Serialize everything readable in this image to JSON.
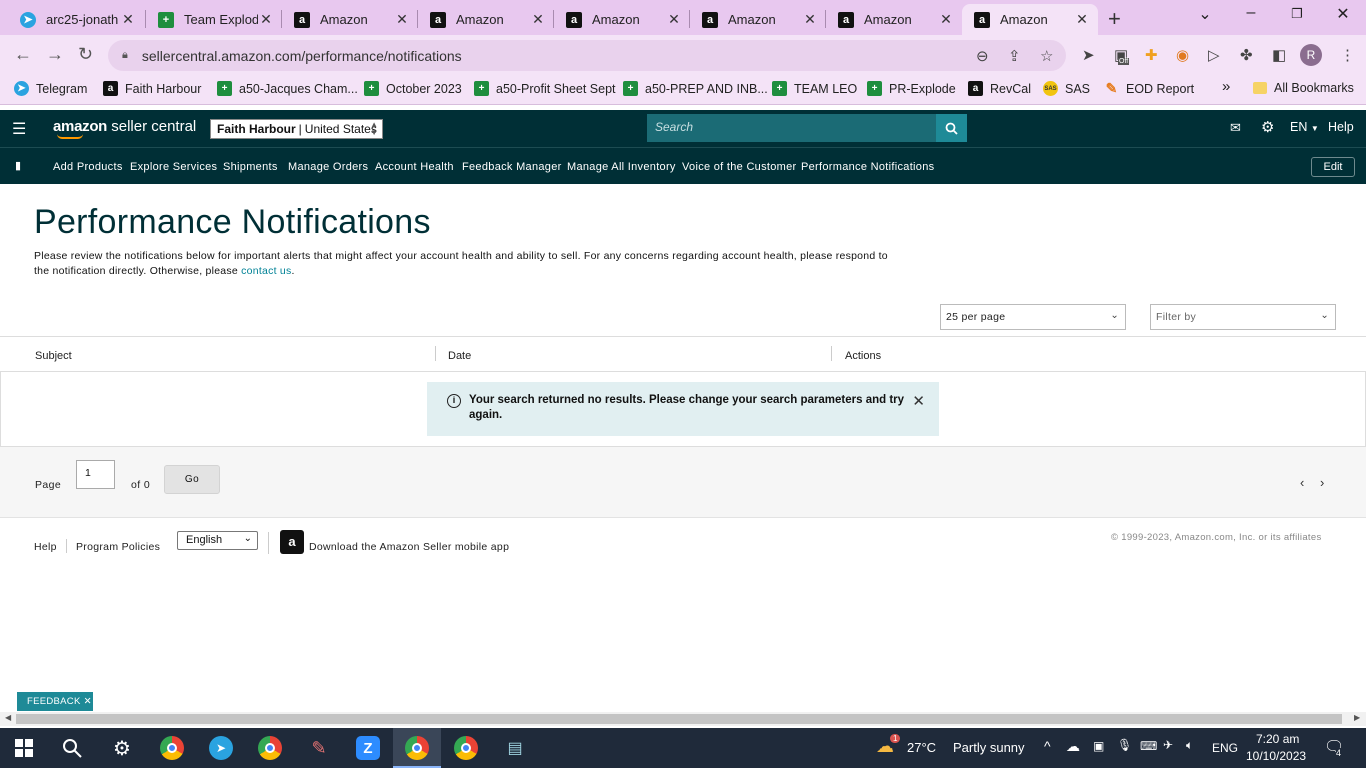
{
  "browser": {
    "tabs": [
      {
        "title": "arc25-jonath",
        "fav": "telegram-icon"
      },
      {
        "title": "Team Explod",
        "fav": "sheets-icon"
      },
      {
        "title": "Amazon",
        "fav": "amazon-icon"
      },
      {
        "title": "Amazon",
        "fav": "amazon-icon"
      },
      {
        "title": "Amazon",
        "fav": "amazon-icon"
      },
      {
        "title": "Amazon",
        "fav": "amazon-icon"
      },
      {
        "title": "Amazon",
        "fav": "amazon-icon"
      },
      {
        "title": "Amazon",
        "fav": "amazon-icon",
        "active": true
      }
    ],
    "url": "sellercentral.amazon.com/performance/notifications",
    "bookmarks": [
      {
        "label": "Telegram"
      },
      {
        "label": "Faith Harbour"
      },
      {
        "label": "a50-Jacques Cham..."
      },
      {
        "label": "October 2023"
      },
      {
        "label": "a50-Profit Sheet Sept"
      },
      {
        "label": "a50-PREP AND INB..."
      },
      {
        "label": "TEAM LEO"
      },
      {
        "label": "PR-Explode"
      },
      {
        "label": "RevCal"
      },
      {
        "label": "SAS"
      },
      {
        "label": "EOD Report"
      }
    ],
    "bookmarks_overflow": "»",
    "all_bookmarks": "All Bookmarks",
    "profile_initial": "R",
    "ext_badge": "Off"
  },
  "header": {
    "logo_main": "amazon",
    "logo_sub": "seller central",
    "account_name": "Faith Harbour",
    "account_region": "United States",
    "search_placeholder": "Search",
    "lang": "EN",
    "help": "Help"
  },
  "nav": {
    "links": [
      "Add Products",
      "Explore Services",
      "Shipments",
      "Manage Orders",
      "Account Health",
      "Feedback Manager",
      "Manage All Inventory",
      "Voice of the Customer",
      "Performance Notifications"
    ],
    "edit": "Edit"
  },
  "page": {
    "title": "Performance Notifications",
    "intro_text": "Please review the notifications below for important alerts that might affect your account health and ability to sell. For any concerns regarding account health, please respond to the notification directly. Otherwise, please ",
    "intro_link": "contact us",
    "intro_end": ".",
    "per_page": "25 per page",
    "filter_placeholder": "Filter by",
    "columns": [
      "Subject",
      "Date",
      "Actions"
    ],
    "alert": "Your search returned no results. Please change your search parameters and try again."
  },
  "pager": {
    "label": "Page",
    "current": "1",
    "of_text": "of 0",
    "go": "Go"
  },
  "footer": {
    "help": "Help",
    "policies": "Program Policies",
    "language": "English",
    "app_text": "Download the Amazon Seller mobile app",
    "copyright": "© 1999-2023, Amazon.com, Inc. or its affiliates"
  },
  "feedback": "FEEDBACK",
  "taskbar": {
    "weather_temp": "27°C",
    "weather_desc": "Partly sunny",
    "weather_badge": "1",
    "lang": "ENG",
    "time": "7:20 am",
    "date": "10/10/2023",
    "notif_count": "4"
  },
  "colors": {
    "header_bg": "#002f36",
    "accent": "#1e8a97",
    "chrome_bg": "#e8c8ef"
  }
}
